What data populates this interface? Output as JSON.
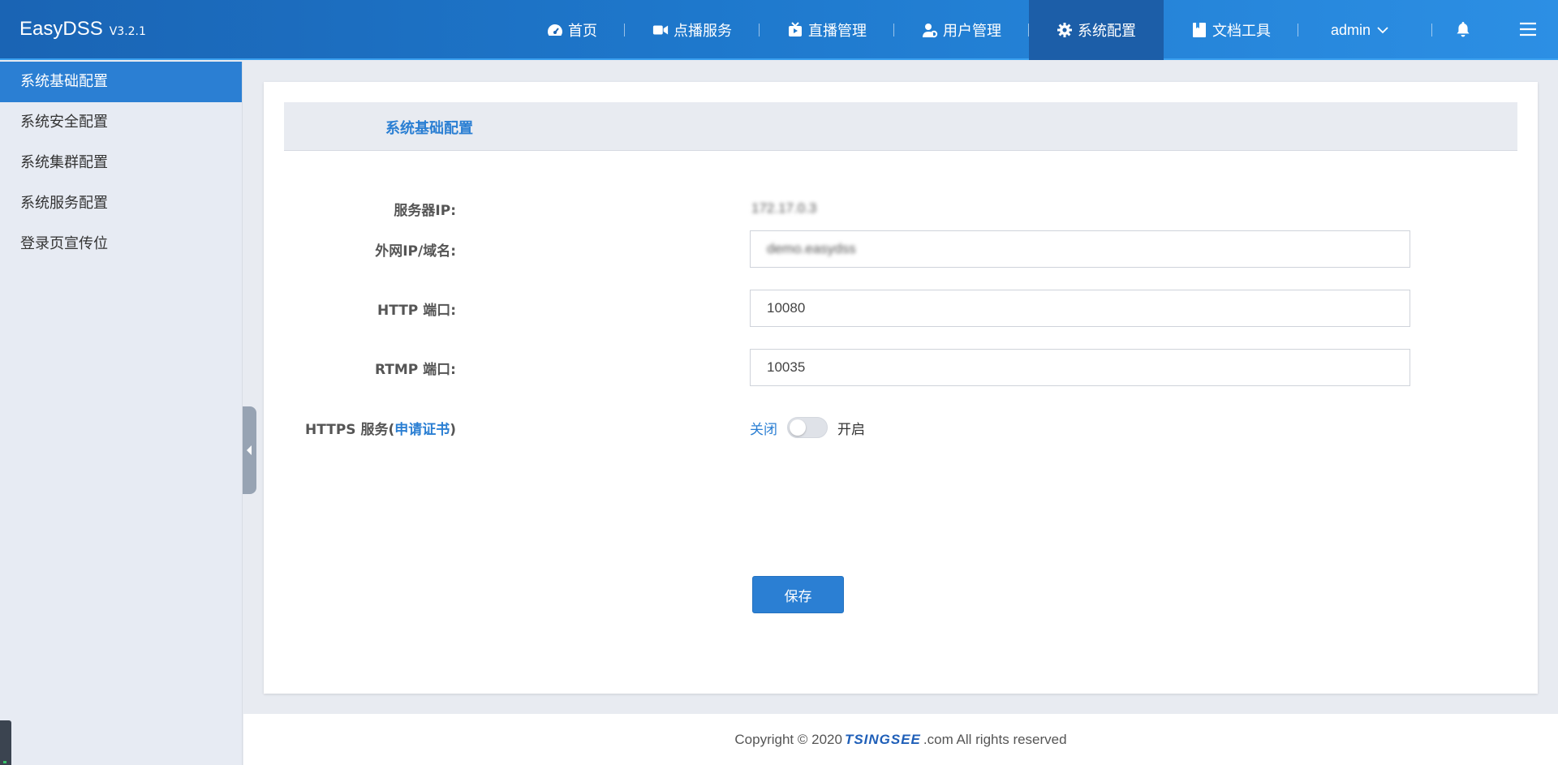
{
  "header": {
    "app_name": "EasyDSS",
    "version": "V3.2.1",
    "nav": [
      {
        "label": "首页",
        "icon": "dashboard-icon"
      },
      {
        "label": "点播服务",
        "icon": "video-camera-icon"
      },
      {
        "label": "直播管理",
        "icon": "tv-play-icon"
      },
      {
        "label": "用户管理",
        "icon": "user-gear-icon"
      },
      {
        "label": "系统配置",
        "icon": "gear-icon",
        "active": true
      },
      {
        "label": "文档工具",
        "icon": "bookmark-icon"
      }
    ],
    "user": "admin",
    "colors": {
      "bar_start": "#1a64b4",
      "bar_end": "#2c8fe4",
      "active_tab": "#1c5ea8"
    }
  },
  "sidebar": {
    "items": [
      {
        "label": "系统基础配置",
        "active": true
      },
      {
        "label": "系统安全配置"
      },
      {
        "label": "系统集群配置"
      },
      {
        "label": "系统服务配置"
      },
      {
        "label": "登录页宣传位"
      }
    ],
    "accent": "#2b7fd3"
  },
  "form": {
    "title": "系统基础配置",
    "server_ip": {
      "label": "服务器IP:",
      "value": "172.17.0.3"
    },
    "public_ip": {
      "label": "外网IP/域名:",
      "value": "demo.easydss"
    },
    "http_port": {
      "label": "HTTP 端口:",
      "value": "10080"
    },
    "rtmp_port": {
      "label": "RTMP 端口:",
      "value": "10035"
    },
    "https": {
      "label_prefix": "HTTPS 服务(",
      "apply_link": "申请证书",
      "label_suffix": ")",
      "off_label": "关闭",
      "on_label": "开启",
      "enabled": false
    },
    "save_label": "保存"
  },
  "footer": {
    "prefix": "Copyright © 2020 ",
    "brand": "TSINGSEE",
    "suffix": ".com All rights reserved"
  }
}
